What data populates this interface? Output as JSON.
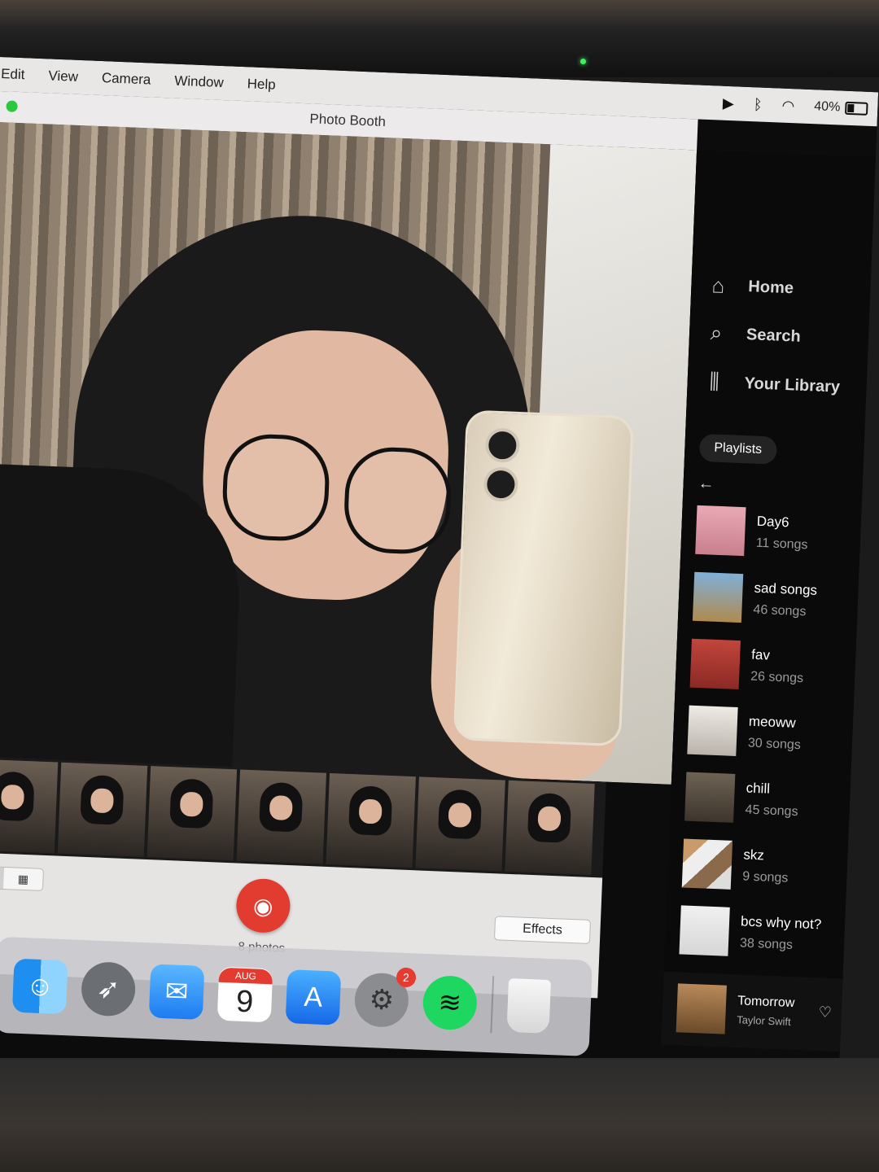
{
  "menubar": {
    "items": [
      "Edit",
      "View",
      "Camera",
      "Window",
      "Help"
    ],
    "battery": "40%"
  },
  "window": {
    "title": "Photo Booth"
  },
  "photo_booth": {
    "photo_count": "8 photos",
    "effects_label": "Effects"
  },
  "dock": {
    "calendar_month": "AUG",
    "calendar_day": "9",
    "settings_badge": "2",
    "apps": [
      "finder-icon",
      "launchpad-icon",
      "mail-icon",
      "calendar-icon",
      "app-store-icon",
      "system-settings-icon",
      "spotify-icon",
      "trash-icon"
    ]
  },
  "spotify": {
    "nav": [
      "Home",
      "Search",
      "Your Library"
    ],
    "chip": "Playlists",
    "playlists": [
      {
        "name": "Day6",
        "count": "11 songs"
      },
      {
        "name": "sad songs",
        "count": "46 songs"
      },
      {
        "name": "fav",
        "count": "26 songs"
      },
      {
        "name": "meoww",
        "count": "30 songs"
      },
      {
        "name": "chill",
        "count": "45 songs"
      },
      {
        "name": "skz",
        "count": "9 songs"
      },
      {
        "name": "bcs why not?",
        "count": "38 songs"
      }
    ],
    "now_playing": {
      "title": "Tomorrow",
      "artist": "Taylor Swift"
    },
    "accent": "#1ed760"
  }
}
